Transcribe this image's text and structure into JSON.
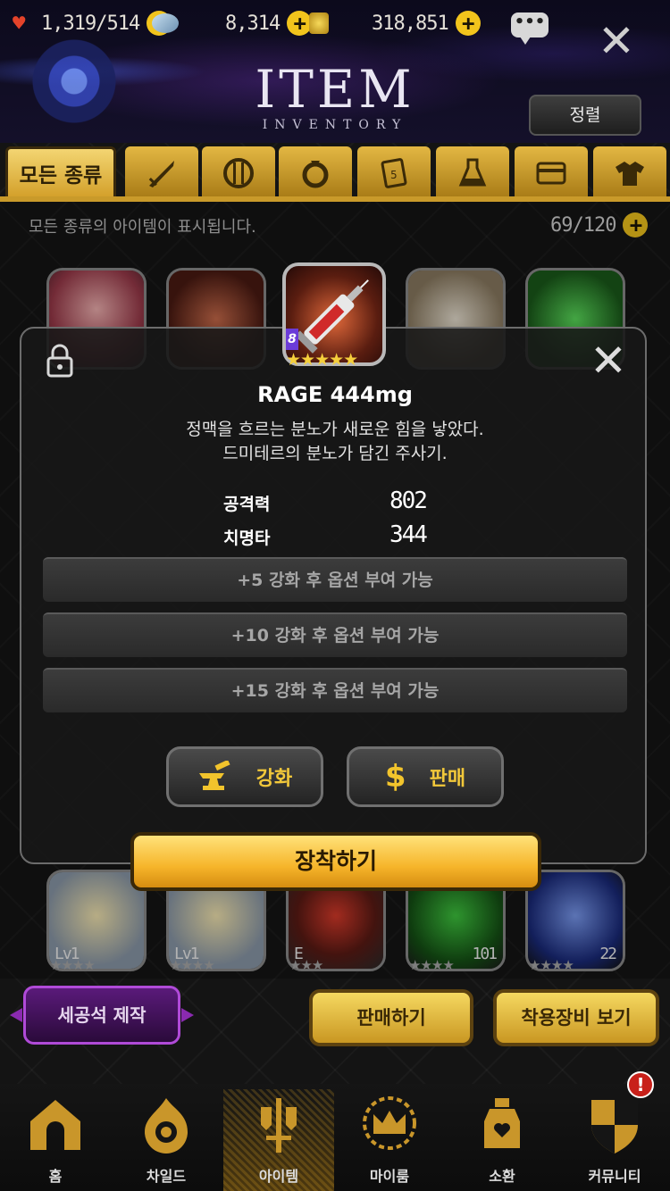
{
  "resources": {
    "stamina": "1,319",
    "stamina_max": "/514",
    "gems": "8,314",
    "gold": "318,851"
  },
  "header": {
    "title": "ITEM",
    "subtitle": "INVENTORY",
    "sort_label": "정렬",
    "chat_icon": "chat-bubble-icon",
    "close_icon": "close-icon"
  },
  "tabs": [
    {
      "label": "모든 종류",
      "icon": "all-types",
      "active": true
    },
    {
      "label": "",
      "icon": "sword-icon"
    },
    {
      "label": "",
      "icon": "shield-icon"
    },
    {
      "label": "",
      "icon": "ring-icon"
    },
    {
      "label": "",
      "icon": "card-icon"
    },
    {
      "label": "",
      "icon": "potion-flask-icon"
    },
    {
      "label": "",
      "icon": "box-icon"
    },
    {
      "label": "",
      "icon": "costume-shirt-icon"
    }
  ],
  "info": {
    "description": "모든 종류의 아이템이 표시됩니다.",
    "capacity": "69/120"
  },
  "grid_bottom": [
    {
      "level": "Lv1",
      "count": ""
    },
    {
      "level": "Lv1",
      "count": ""
    },
    {
      "level": "E",
      "count": ""
    },
    {
      "level": "",
      "count": "101"
    },
    {
      "level": "",
      "count": "22"
    }
  ],
  "modal": {
    "tier": "8",
    "stars": "★★★★★",
    "item_name": "RAGE 444mg",
    "description_line1": "정맥을 흐르는 분노가 새로운 힘을 낳았다.",
    "description_line2": "드미테르의 분노가 담긴 주사기.",
    "stats": [
      {
        "label": "공격력",
        "value": "802"
      },
      {
        "label": "치명타",
        "value": "344"
      }
    ],
    "options": [
      "+5 강화 후 옵션 부여 가능",
      "+10 강화 후 옵션 부여 가능",
      "+15 강화 후 옵션 부여 가능"
    ],
    "enhance_label": "강화",
    "sell_label": "판매",
    "equip_label": "장착하기"
  },
  "actions": {
    "gem_craft": "세공석 제작",
    "sell": "판매하기",
    "view_equipped": "착용장비 보기"
  },
  "nav": [
    {
      "label": "홈",
      "icon": "home-icon"
    },
    {
      "label": "차일드",
      "icon": "child-flame-icon"
    },
    {
      "label": "아이템",
      "icon": "item-sword-icon",
      "active": true
    },
    {
      "label": "마이룸",
      "icon": "myroom-crown-icon"
    },
    {
      "label": "소환",
      "icon": "summon-bottle-icon"
    },
    {
      "label": "커뮤니티",
      "icon": "community-shield-icon"
    }
  ],
  "alert_badge": "!",
  "colors": {
    "gold": "#f2c41c",
    "tab_gold": "#d3a02a",
    "purple": "#b04ad8"
  }
}
